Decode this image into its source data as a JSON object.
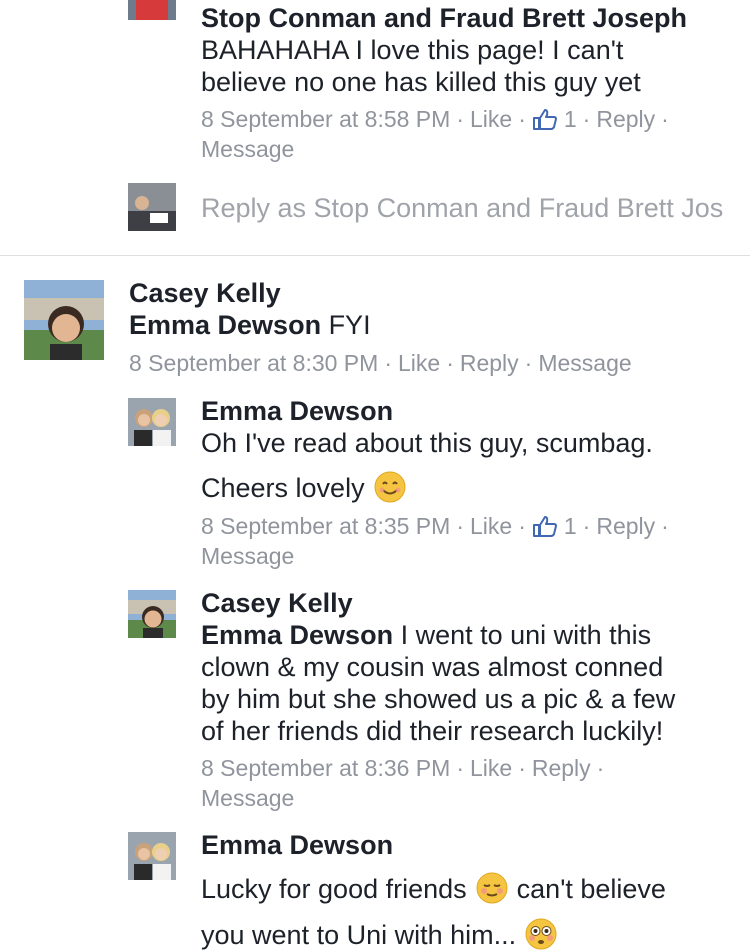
{
  "thread1": {
    "comment": {
      "author": "Stop Conman and Fraud Brett Joseph",
      "text_line1": "BAHAHAHA I love this page! I can't",
      "text_line2": "believe no one has killed this guy yet",
      "timestamp": "8 September at 8:58 PM",
      "like": "Like",
      "likes_count": "1",
      "reply": "Reply",
      "message": "Message"
    },
    "reply_as_placeholder": "Reply as Stop Conman and Fraud Brett Jos"
  },
  "thread2": {
    "comment": {
      "author": "Casey Kelly",
      "mention": "Emma Dewson",
      "text": " FYI",
      "timestamp": "8 September at 8:30 PM",
      "like": "Like",
      "reply": "Reply",
      "message": "Message"
    },
    "replies": [
      {
        "author": "Emma Dewson",
        "text_line1": "Oh I've read about this guy, scumbag.",
        "text_line2": "Cheers lovely",
        "emoji": "smiling-face-emoji",
        "timestamp": "8 September at 8:35 PM",
        "like": "Like",
        "likes_count": "1",
        "reply": "Reply",
        "message": "Message"
      },
      {
        "author": "Casey Kelly",
        "mention": "Emma Dewson",
        "text_line1": " I went to uni with this",
        "text_line2": "clown & my cousin was almost conned",
        "text_line3": "by him but she showed us a pic & a few",
        "text_line4": "of her friends did their research luckily!",
        "timestamp": "8 September at 8:36 PM",
        "like": "Like",
        "reply": "Reply",
        "message": "Message"
      },
      {
        "author": "Emma Dewson",
        "text_line1a": "Lucky for good friends",
        "text_line1b": "can't believe",
        "text_line2": "you went to Uni with him...",
        "emoji1": "blushing-face-emoji",
        "emoji2": "flushed-face-emoji"
      }
    ]
  },
  "colors": {
    "text": "#1d2129",
    "meta": "#90949c",
    "link_blue": "#4267b2",
    "divider": "#dddfe2"
  }
}
